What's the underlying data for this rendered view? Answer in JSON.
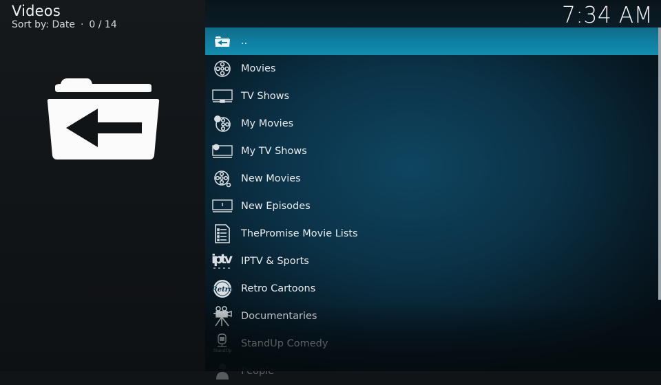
{
  "header": {
    "title": "Videos",
    "sort_label": "Sort by: Date",
    "separator": "·",
    "position": "0 / 14"
  },
  "clock": "7:34 AM",
  "preview": {
    "icon": "folder-back-icon"
  },
  "list": {
    "focused_index": 0,
    "items": [
      {
        "label": "..",
        "icon": "folder-back-icon"
      },
      {
        "label": "Movies",
        "icon": "film-reel-icon"
      },
      {
        "label": "TV Shows",
        "icon": "tv-icon"
      },
      {
        "label": "My Movies",
        "icon": "my-movies-reel-icon"
      },
      {
        "label": "My TV Shows",
        "icon": "my-tv-icon"
      },
      {
        "label": "New Movies",
        "icon": "new-movies-reel-icon"
      },
      {
        "label": "New Episodes",
        "icon": "new-episodes-tv-icon"
      },
      {
        "label": "ThePromise Movie Lists",
        "icon": "document-list-icon"
      },
      {
        "label": "IPTV & Sports",
        "icon": "iptv-logo-icon"
      },
      {
        "label": "Retro Cartoons",
        "icon": "retro-badge-icon"
      },
      {
        "label": "Documentaries",
        "icon": "camera-tripod-icon"
      },
      {
        "label": "StandUp Comedy",
        "icon": "standup-mic-icon"
      },
      {
        "label": "People",
        "icon": "person-icon"
      }
    ]
  },
  "colors": {
    "focus": "#0f7ea1",
    "background_left": "#111417",
    "background_right": "#0b3247",
    "text": "#e8ecee"
  },
  "scrollbar": {
    "visible_fraction": 0.93,
    "position_fraction": 0.0
  }
}
